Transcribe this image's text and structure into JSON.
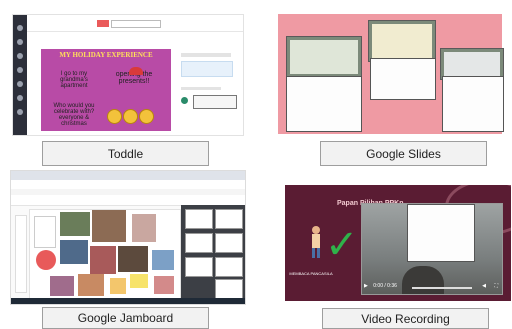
{
  "panels": {
    "toddle": {
      "label": "Toddle",
      "header_title": "",
      "card": {
        "title": "MY HOLIDAY EXPERIENCE",
        "q1": "",
        "a1": "I go to my grandma's apartment",
        "q2": "",
        "a2": "opening the presents!!",
        "q3": "",
        "a3": "Who would you celebrate with? everyone & christmas"
      }
    },
    "slides": {
      "label": "Google Slides"
    },
    "jamboard": {
      "label": "Google Jamboard"
    },
    "video": {
      "label": "Video Recording",
      "slide_title": "Papan Pilihan PPKn",
      "caption": "MEMBACA PANCASILA",
      "time": "0:00 / 0:36"
    }
  },
  "colors": {
    "slides_bg": "#ef9aa3",
    "toddle_card": "#b84ba6",
    "video_bg": "#5a1c33",
    "check": "#2fb24a"
  }
}
